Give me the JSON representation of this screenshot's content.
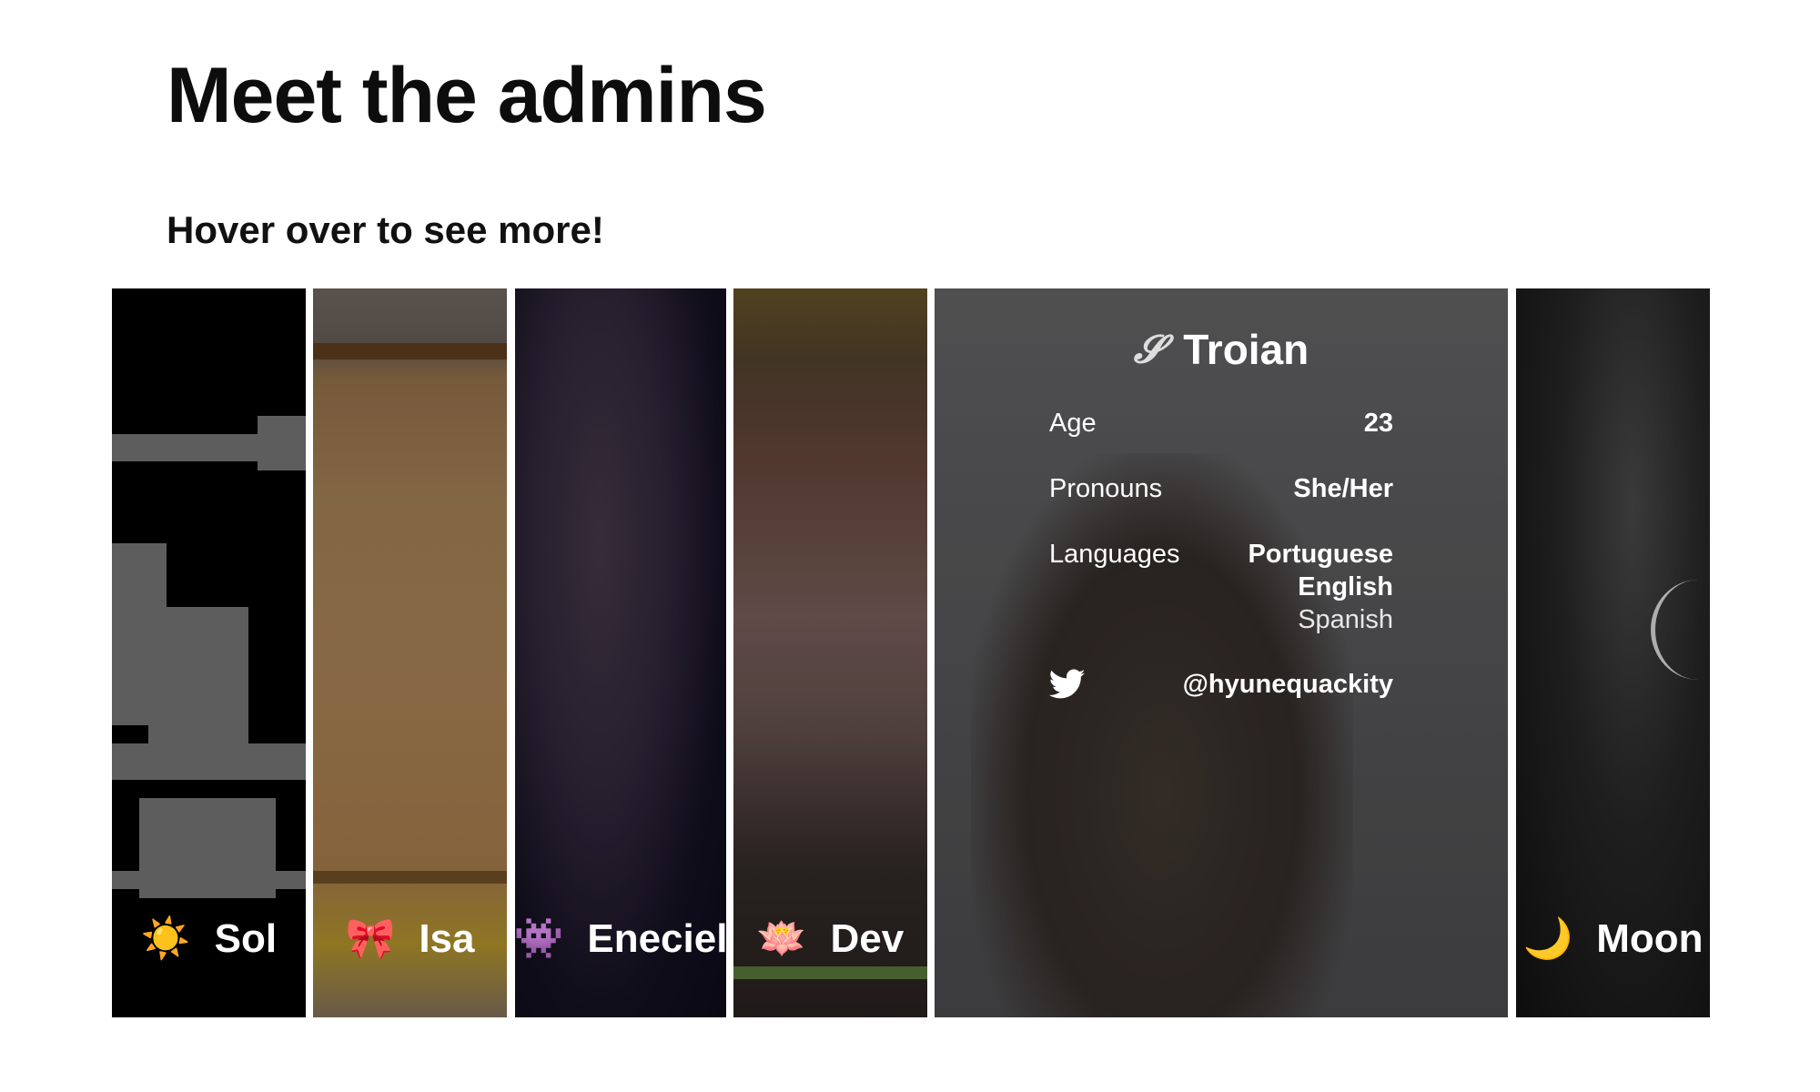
{
  "page": {
    "title": "Meet the admins",
    "subtitle": "Hover over to see more!"
  },
  "admins": [
    {
      "name": "Sol",
      "emoji": "☀️",
      "icon": "sun-icon"
    },
    {
      "name": "Isa",
      "emoji": "🎀",
      "icon": "ribbon-icon"
    },
    {
      "name": "Eneciel",
      "emoji": "👾",
      "icon": "alien-monster-icon"
    },
    {
      "name": "Dev",
      "emoji": "🪷",
      "icon": "lotus-icon"
    },
    {
      "name": "Troian",
      "emoji": "𝓢",
      "icon": "snake-icon",
      "expanded": true,
      "details": {
        "age_label": "Age",
        "age_value": "23",
        "pronouns_label": "Pronouns",
        "pronouns_value": "She/Her",
        "languages_label": "Languages",
        "languages": [
          "Portuguese",
          "English",
          "Spanish"
        ],
        "twitter_handle": "@hyunequackity",
        "twitter_icon": "twitter-bird-icon"
      }
    },
    {
      "name": "Moon",
      "emoji": "🌙",
      "icon": "crescent-moon-icon"
    }
  ],
  "colors": {
    "twitter": "#ffffff",
    "sun": "#f5a623",
    "ribbon": "#d92d3a",
    "alien": "#6a4aa0",
    "lotus": "#f08aa0",
    "moon": "#f2c14e"
  }
}
